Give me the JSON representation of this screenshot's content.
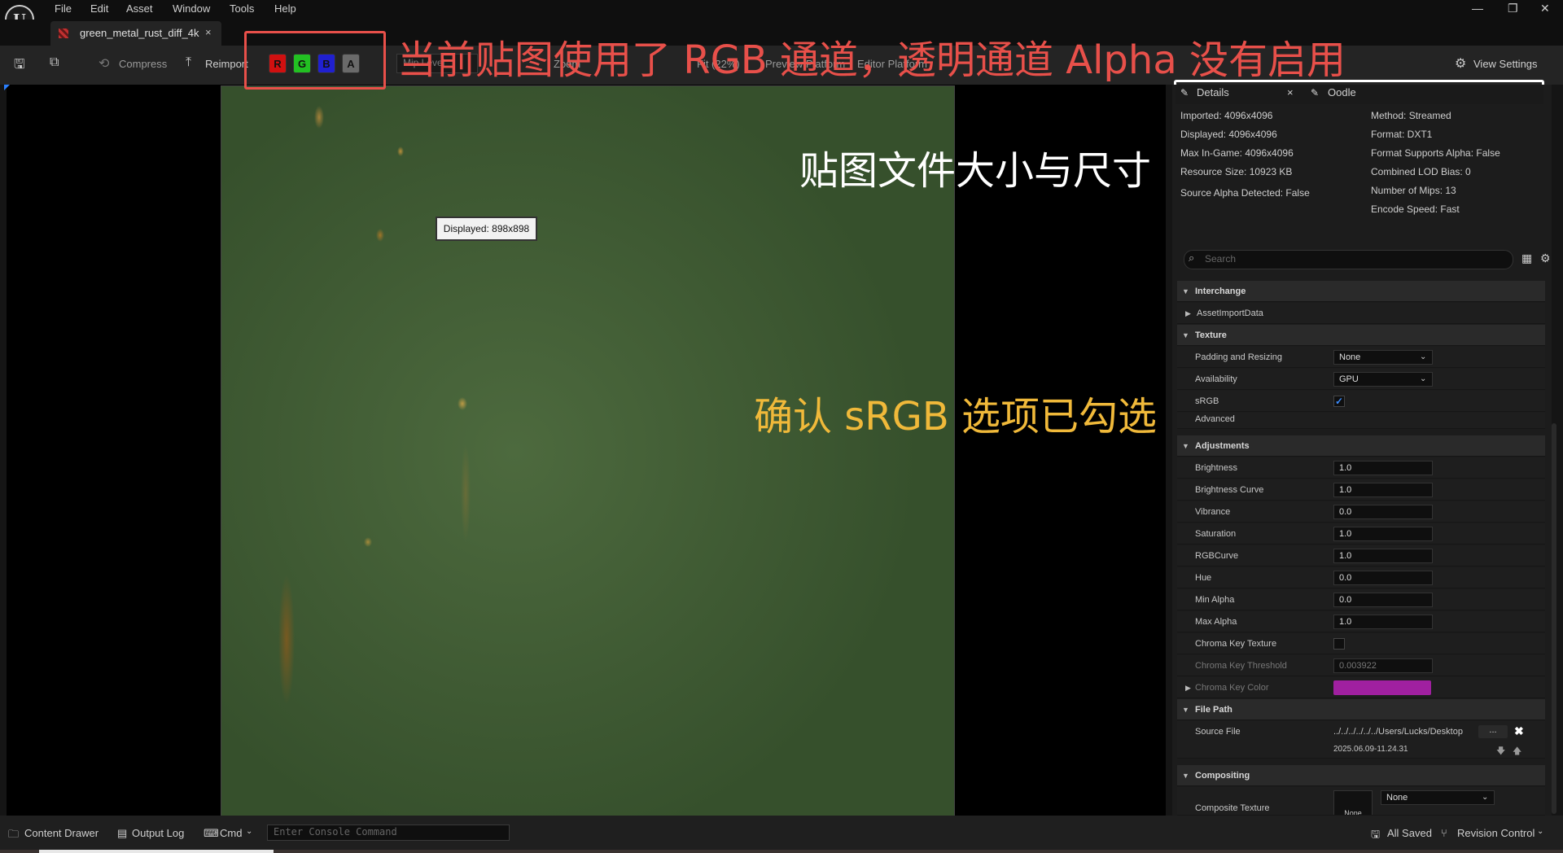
{
  "menu": [
    "File",
    "Edit",
    "Asset",
    "Window",
    "Tools",
    "Help"
  ],
  "window_controls": {
    "minimize": "—",
    "restore": "❐",
    "close": "✕"
  },
  "tab": {
    "title": "green_metal_rust_diff_4k",
    "close": "×"
  },
  "toolbar": {
    "compress": "Compress",
    "reimport": "Reimport",
    "channels": [
      "R",
      "G",
      "B",
      "A"
    ],
    "mip_level": "Mip Level",
    "zoom": "Zoom",
    "fit": "Fit (22%)",
    "preview_platform": "Preview Platform",
    "editor_platform": "Editor Platform",
    "view_settings": "View Settings"
  },
  "viewport": {
    "tooltip": "Displayed: 898x898"
  },
  "annotations": {
    "channels_note": "当前贴图使用了 RGB 通道，透明通道 Alpha 没有启用",
    "size_note": "贴图文件大小与尺寸",
    "srgb_note": "确认 sRGB 选项已勾选"
  },
  "details": {
    "tabs": [
      "Details",
      "Oodle"
    ],
    "close": "×",
    "info_left": [
      "Imported: 4096x4096",
      "Displayed: 4096x4096",
      "Max In-Game: 4096x4096",
      "Resource Size: 10923 KB",
      "Source Alpha Detected: False"
    ],
    "info_right": [
      "Method: Streamed",
      "Format: DXT1",
      "Format Supports Alpha: False",
      "Combined LOD Bias: 0",
      "Number of Mips: 13",
      "Encode Speed: Fast"
    ],
    "search_placeholder": "Search"
  },
  "properties": {
    "interchange": "Interchange",
    "asset_import_data": "AssetImportData",
    "texture": "Texture",
    "padding": {
      "label": "Padding and Resizing",
      "value": "None"
    },
    "availability": {
      "label": "Availability",
      "value": "GPU"
    },
    "srgb": {
      "label": "sRGB",
      "checked": true,
      "check": "✓"
    },
    "advanced": "Advanced",
    "adjustments": "Adjustments",
    "adj_rows": [
      {
        "label": "Brightness",
        "value": "1.0"
      },
      {
        "label": "Brightness Curve",
        "value": "1.0"
      },
      {
        "label": "Vibrance",
        "value": "0.0"
      },
      {
        "label": "Saturation",
        "value": "1.0"
      },
      {
        "label": "RGBCurve",
        "value": "1.0"
      },
      {
        "label": "Hue",
        "value": "0.0"
      },
      {
        "label": "Min Alpha",
        "value": "0.0"
      },
      {
        "label": "Max Alpha",
        "value": "1.0"
      }
    ],
    "chroma_key_texture": "Chroma Key Texture",
    "chroma_key_threshold": {
      "label": "Chroma Key Threshold",
      "value": "0.003922"
    },
    "chroma_key_color": {
      "label": "Chroma Key Color",
      "color": "#a020a0"
    },
    "file_path": "File Path",
    "source_file": {
      "label": "Source File",
      "value": "../../../../../../Users/Lucks/Desktop",
      "browse": "...",
      "timestamp": "2025.06.09-11.24.31"
    },
    "compositing": "Compositing",
    "composite_texture": {
      "label": "Composite Texture",
      "thumb": "None",
      "value": "None"
    }
  },
  "bottom": {
    "content_drawer": "Content Drawer",
    "output_log": "Output Log",
    "cmd": "Cmd",
    "console_placeholder": "Enter Console Command",
    "all_saved": "All Saved",
    "revision_control": "Revision Control"
  },
  "colors": {
    "red_anno": "#e8504a",
    "yellow_anno": "#f0b93a",
    "white_box": "#ffffff"
  }
}
